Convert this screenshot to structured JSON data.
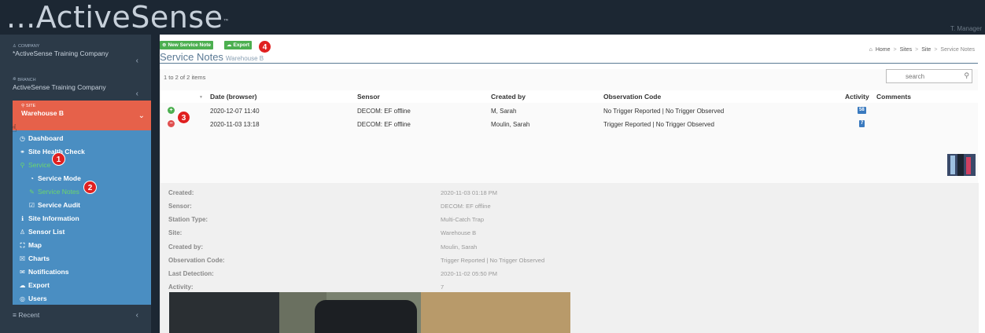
{
  "app": {
    "logo": "...ActiveSense",
    "logo_tm": "™",
    "user_area": "T. Manager"
  },
  "sidebar": {
    "company": {
      "caption": "COMPANY",
      "value": "*ActiveSense Training Company"
    },
    "branch": {
      "caption": "BRANCH",
      "value": "ActiveSense Training Company"
    },
    "site": {
      "caption": "SITE",
      "value": "Warehouse B"
    },
    "menu": [
      {
        "label": "Dashboard",
        "icon": "dashboard-icon",
        "glyph": "◷"
      },
      {
        "label": "Site Health Check",
        "icon": "link-icon",
        "glyph": "⚭"
      },
      {
        "label": "Service",
        "icon": "pin-icon",
        "glyph": "⚲"
      },
      {
        "label": "Service Mode",
        "icon": "clock-icon",
        "glyph": "◔"
      },
      {
        "label": "Service Notes",
        "icon": "note-icon",
        "glyph": "✎"
      },
      {
        "label": "Service Audit",
        "icon": "checkbox-icon",
        "glyph": "☑"
      },
      {
        "label": "Site Information",
        "icon": "info-icon",
        "glyph": "ℹ"
      },
      {
        "label": "Sensor List",
        "icon": "sensor-icon",
        "glyph": "♙"
      },
      {
        "label": "Map",
        "icon": "map-icon",
        "glyph": "⛶"
      },
      {
        "label": "Charts",
        "icon": "chart-icon",
        "glyph": "☒"
      },
      {
        "label": "Notifications",
        "icon": "envelope-icon",
        "glyph": "✉"
      },
      {
        "label": "Export",
        "icon": "cloud-icon",
        "glyph": "☁"
      },
      {
        "label": "Users",
        "icon": "users-icon",
        "glyph": "◎"
      }
    ],
    "recent": "Recent"
  },
  "callouts": [
    "1",
    "2",
    "3",
    "4"
  ],
  "toolbar": {
    "new_note": "New Service Note",
    "export": "Export"
  },
  "page": {
    "title": "Service Notes",
    "subtitle": "Warehouse B"
  },
  "breadcrumb": {
    "home": "Home",
    "sites": "Sites",
    "site": "Site",
    "current": "Service Notes"
  },
  "list": {
    "count": "1 to 2 of 2 items",
    "search_placeholder": "search",
    "columns": [
      "Date (browser)",
      "Sensor",
      "Created by",
      "Observation Code",
      "Activity",
      "Comments"
    ],
    "rows": [
      {
        "date": "2020-12-07 11:40",
        "sensor": "DECOM: EF offline",
        "created_by": "M, Sarah",
        "observation": "No Trigger Reported | No Trigger Observed",
        "activity": "58"
      },
      {
        "date": "2020-11-03 13:18",
        "sensor": "DECOM: EF offline",
        "created_by": "Moulin, Sarah",
        "observation": "Trigger Reported | No Trigger Observed",
        "activity": "7"
      }
    ]
  },
  "details": [
    {
      "label": "Created:",
      "value": "2020-11-03 01:18 PM"
    },
    {
      "label": "Sensor:",
      "value": "DECOM: EF offline"
    },
    {
      "label": "Station Type:",
      "value": "Multi-Catch Trap"
    },
    {
      "label": "Site:",
      "value": "Warehouse B"
    },
    {
      "label": "Created by:",
      "value": "Moulin, Sarah"
    },
    {
      "label": "Observation Code:",
      "value": "Trigger Reported | No Trigger Observed"
    },
    {
      "label": "Last Detection:",
      "value": "2020-11-02 05:50 PM"
    },
    {
      "label": "Activity:",
      "value": "7"
    }
  ],
  "colors": {
    "accent_green": "#4caf50",
    "site_orange": "#e6614a",
    "menu_blue": "#4a8ec2",
    "callout_red": "#e02020"
  }
}
